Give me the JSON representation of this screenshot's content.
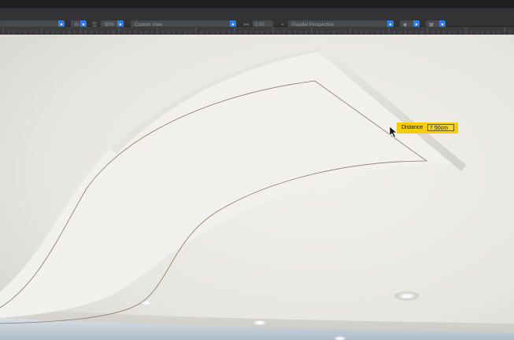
{
  "toolbar": {
    "selects": [
      {
        "label": ""
      },
      {
        "label": "0r"
      },
      {
        "label": "60%"
      },
      {
        "label": "Custom View"
      },
      {
        "label": "0.00"
      },
      {
        "label": "Parallel Perspective"
      }
    ],
    "icons": [
      "lock-icon",
      "link-icon",
      "camera-icon",
      "eye-icon",
      "gear-icon",
      "grid-icon"
    ]
  },
  "measure": {
    "label": "Distance",
    "value": "7.50cm"
  },
  "colors": {
    "accent": "#2f7de0",
    "tooltip": "#f6cd08",
    "toolbar": "#333336",
    "ceiling": "#ecebe6"
  }
}
